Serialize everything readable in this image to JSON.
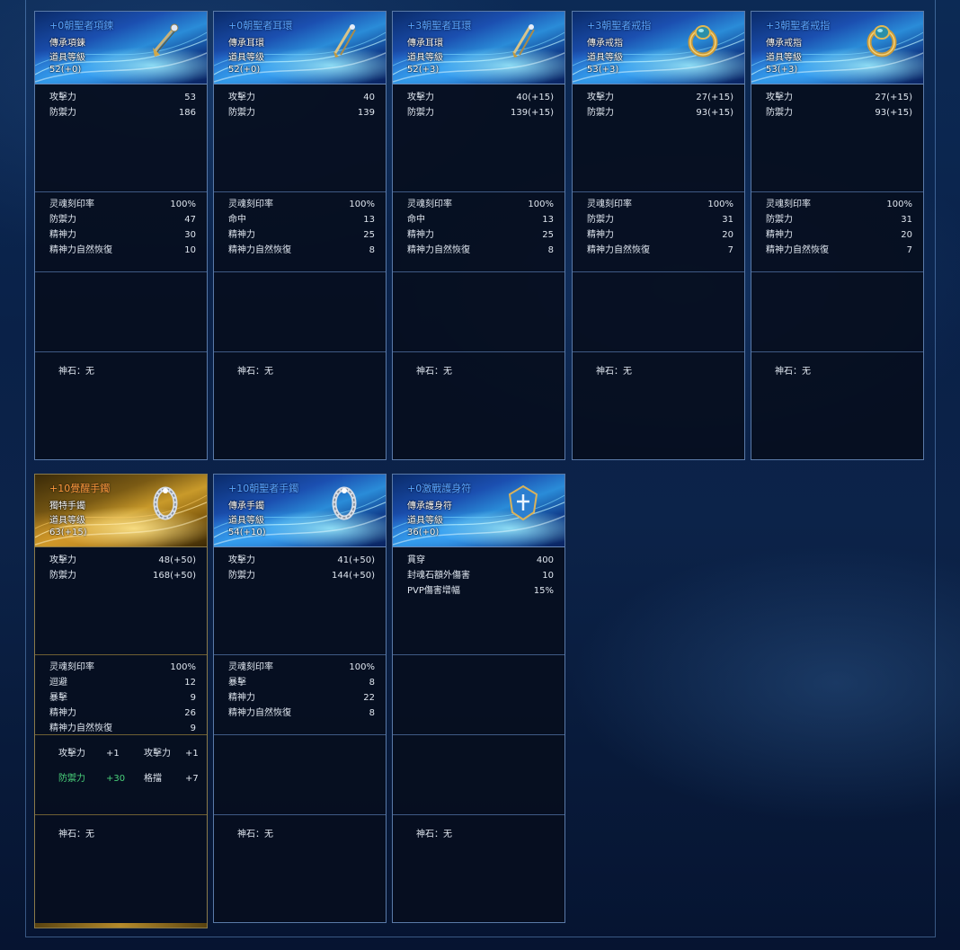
{
  "colors": {
    "title_blue": "#5aa6ff",
    "title_orange": "#ff9a3a",
    "bonus_green": "#49d27a",
    "card_border": "#5a7aa8"
  },
  "cards": [
    {
      "title": "+0朝聖者項鍊",
      "line1": "傳承項鍊",
      "line2": "道具等級",
      "line3": "52(+0)",
      "icon": "necklace-icon",
      "base_stats": [
        [
          "攻擊力",
          "53"
        ],
        [
          "防禦力",
          "186"
        ]
      ],
      "soul_stats": [
        [
          "灵魂刻印率",
          "100%"
        ],
        [
          "防禦力",
          "47"
        ],
        [
          "精神力",
          "30"
        ],
        [
          "精神力自然恢復",
          "10"
        ]
      ],
      "gem": "神石：无"
    },
    {
      "title": "+0朝聖者耳環",
      "line1": "傳承耳環",
      "line2": "道具等级",
      "line3": "52(+0)",
      "icon": "earring-icon",
      "base_stats": [
        [
          "攻擊力",
          "40"
        ],
        [
          "防禦力",
          "139"
        ]
      ],
      "soul_stats": [
        [
          "灵魂刻印率",
          "100%"
        ],
        [
          "命中",
          "13"
        ],
        [
          "精神力",
          "25"
        ],
        [
          "精神力自然恢復",
          "8"
        ]
      ],
      "gem": "神石：无"
    },
    {
      "title": "+3朝聖者耳環",
      "line1": "傳承耳環",
      "line2": "道具等級",
      "line3": "52(+3)",
      "icon": "earring-icon",
      "base_stats": [
        [
          "攻擊力",
          "40(+15)"
        ],
        [
          "防禦力",
          "139(+15)"
        ]
      ],
      "soul_stats": [
        [
          "灵魂刻印率",
          "100%"
        ],
        [
          "命中",
          "13"
        ],
        [
          "精神力",
          "25"
        ],
        [
          "精神力自然恢復",
          "8"
        ]
      ],
      "gem": "神石：无"
    },
    {
      "title": "+3朝聖者戒指",
      "line1": "傳承戒指",
      "line2": "道具等級",
      "line3": "53(+3)",
      "icon": "ring-icon",
      "base_stats": [
        [
          "攻擊力",
          "27(+15)"
        ],
        [
          "防禦力",
          "93(+15)"
        ]
      ],
      "soul_stats": [
        [
          "灵魂刻印率",
          "100%"
        ],
        [
          "防禦力",
          "31"
        ],
        [
          "精神力",
          "20"
        ],
        [
          "精神力自然恢復",
          "7"
        ]
      ],
      "gem": "神石：无"
    },
    {
      "title": "+3朝聖者戒指",
      "line1": "傳承戒指",
      "line2": "道具等級",
      "line3": "53(+3)",
      "icon": "ring-icon",
      "base_stats": [
        [
          "攻擊力",
          "27(+15)"
        ],
        [
          "防禦力",
          "93(+15)"
        ]
      ],
      "soul_stats": [
        [
          "灵魂刻印率",
          "100%"
        ],
        [
          "防禦力",
          "31"
        ],
        [
          "精神力",
          "20"
        ],
        [
          "精神力自然恢復",
          "7"
        ]
      ],
      "gem": "神石：无"
    },
    {
      "title": "+10覺醒手鐲",
      "line1": "獨特手鐲",
      "line2": "道具等级",
      "line3": "63(+15)",
      "icon": "bracelet-icon",
      "base_stats": [
        [
          "攻擊力",
          "48(+50)"
        ],
        [
          "防禦力",
          "168(+50)"
        ]
      ],
      "soul_stats": [
        [
          "灵魂刻印率",
          "100%"
        ],
        [
          "迴避",
          "12"
        ],
        [
          "暴擊",
          "9"
        ],
        [
          "精神力",
          "26"
        ],
        [
          "精神力自然恢復",
          "9"
        ]
      ],
      "set_bonus": [
        [
          "攻擊力",
          "+1",
          "攻擊力",
          "+1"
        ],
        [
          "防禦力",
          "+30",
          "格擋",
          "+7"
        ]
      ],
      "gem": "神石：无"
    },
    {
      "title": "+10朝聖者手鐲",
      "line1": "傳承手鐲",
      "line2": "道具等級",
      "line3": "54(+10)",
      "icon": "bracelet-icon",
      "base_stats": [
        [
          "攻擊力",
          "41(+50)"
        ],
        [
          "防禦力",
          "144(+50)"
        ]
      ],
      "soul_stats": [
        [
          "灵魂刻印率",
          "100%"
        ],
        [
          "暴擊",
          "8"
        ],
        [
          "精神力",
          "22"
        ],
        [
          "精神力自然恢復",
          "8"
        ]
      ],
      "gem": "神石：无"
    },
    {
      "title": "+0激戰護身符",
      "line1": "傳承護身符",
      "line2": "道具等級",
      "line3": "36(+0)",
      "icon": "amulet-icon",
      "base_stats": [
        [
          "貫穿",
          "400"
        ],
        [
          "封魂石額外傷害",
          "10"
        ],
        [
          "PVP傷害增幅",
          "15%"
        ]
      ],
      "soul_stats": [],
      "gem": "神石：无"
    }
  ]
}
